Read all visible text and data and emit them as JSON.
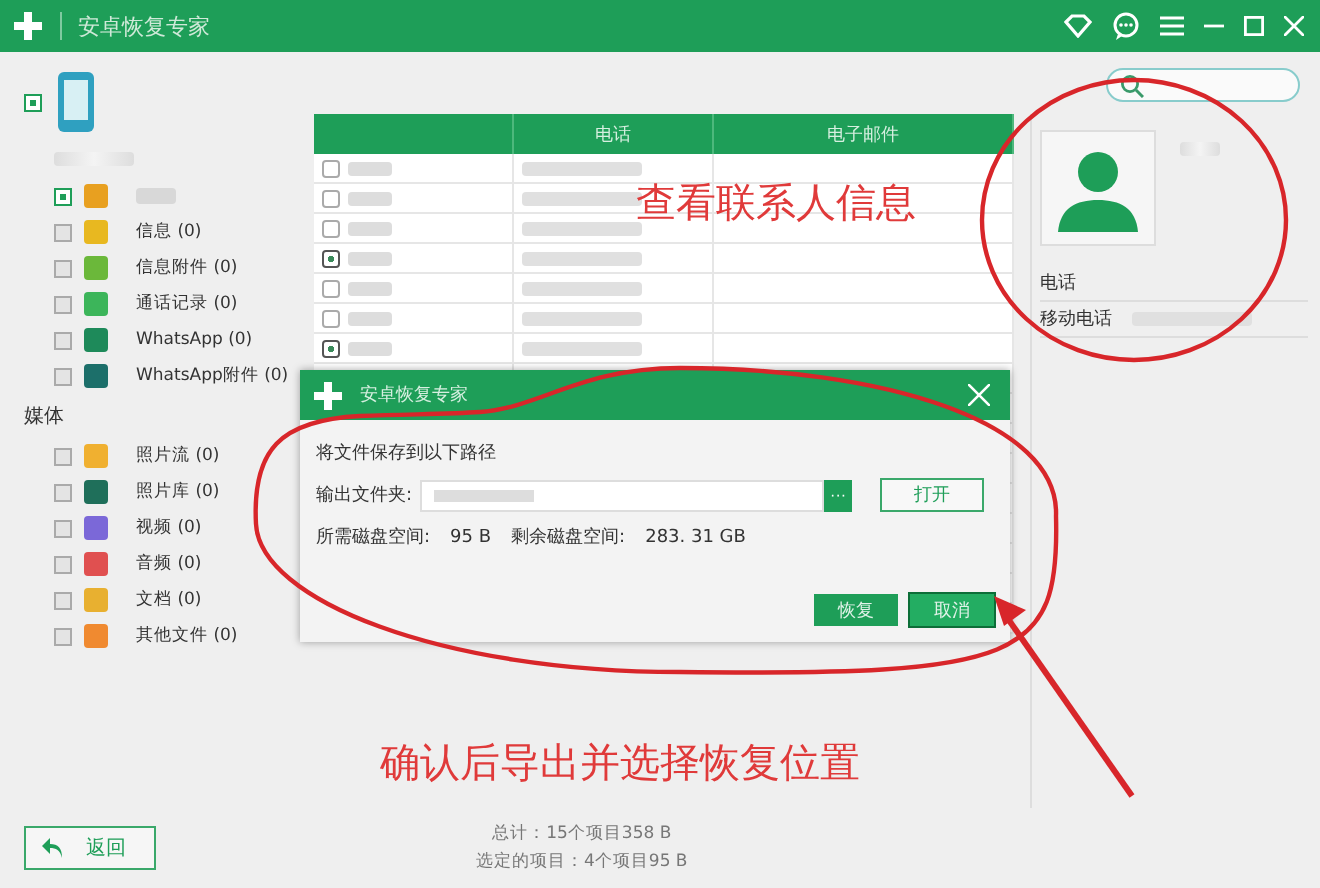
{
  "window": {
    "title": "安卓恢复专家"
  },
  "sidebar": {
    "device": {
      "checked": true
    },
    "items": [
      {
        "checked": true,
        "color": "#e8a020"
      },
      {
        "label": "信息 (0)",
        "checked": false,
        "color": "#e8b820"
      },
      {
        "label": "信息附件 (0)",
        "checked": false,
        "color": "#6bb83a"
      },
      {
        "label": "通话记录 (0)",
        "checked": false,
        "color": "#3cb55a"
      },
      {
        "label": "WhatsApp (0)",
        "checked": false,
        "color": "#1e8a5a"
      },
      {
        "label": "WhatsApp附件 (0)",
        "checked": false,
        "color": "#1c6f6a"
      }
    ],
    "media_heading": "媒体",
    "media": [
      {
        "label": "照片流 (0)",
        "checked": false,
        "color": "#f0b030"
      },
      {
        "label": "照片库 (0)",
        "checked": false,
        "color": "#1f6f5a"
      },
      {
        "label": "视频 (0)",
        "checked": false,
        "color": "#7b68d8"
      },
      {
        "label": "音频 (0)",
        "checked": false,
        "color": "#e05050"
      },
      {
        "label": "文档 (0)",
        "checked": false,
        "color": "#e8b030"
      },
      {
        "label": "其他文件 (0)",
        "checked": false,
        "color": "#f08a30"
      }
    ]
  },
  "table": {
    "columns": [
      "",
      "电话",
      "电子邮件"
    ],
    "rows": [
      {
        "checked": false
      },
      {
        "checked": false
      },
      {
        "checked": false
      },
      {
        "checked": true
      },
      {
        "checked": false
      },
      {
        "checked": false
      },
      {
        "checked": true
      }
    ]
  },
  "detail": {
    "phone_heading": "电话",
    "phone_label": "移动电话"
  },
  "dialog": {
    "title": "安卓恢复专家",
    "prompt": "将文件保存到以下路径",
    "folder_label": "输出文件夹:",
    "browse": "···",
    "open": "打开",
    "space_needed_label": "所需磁盘空间:",
    "space_needed": "95 B",
    "space_free_label": "剩余磁盘空间:",
    "space_free": "283. 31 GB",
    "buttons": [
      {
        "label": "恢复",
        "selected": false
      },
      {
        "label": "取消",
        "selected": true
      }
    ]
  },
  "footer": {
    "back": "返回",
    "total": "总计：15个项目358 B",
    "selected": "选定的项目：4个项目95 B"
  },
  "annotations": [
    {
      "text": "查看联系人信息"
    },
    {
      "text": "确认后导出并选择恢复位置"
    }
  ]
}
